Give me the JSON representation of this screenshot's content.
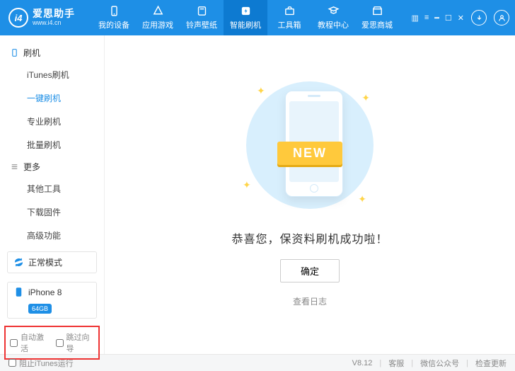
{
  "app": {
    "brand": "爱思助手",
    "site_url": "www.i4.cn",
    "version": "V8.12"
  },
  "nav": {
    "devices": "我的设备",
    "games": "应用游戏",
    "wallpapers": "铃声壁纸",
    "flash": "智能刷机",
    "toolbox": "工具箱",
    "tutorial": "教程中心",
    "shop": "爱思商城"
  },
  "sidebar": {
    "group_flash": "刷机",
    "items_flash": {
      "itunes": "iTunes刷机",
      "oneclick": "一键刷机",
      "pro": "专业刷机",
      "batch": "批量刷机"
    },
    "group_more": "更多",
    "items_more": {
      "other": "其他工具",
      "download": "下载固件",
      "advanced": "高级功能"
    },
    "mode_label": "正常模式",
    "device_name": "iPhone 8",
    "device_capacity": "64GB",
    "auto_activate": "自动激活",
    "skip_wizard": "跳过向导"
  },
  "main": {
    "ribbon": "NEW",
    "success_msg": "恭喜您，保资料刷机成功啦！",
    "ok_btn": "确定",
    "view_log": "查看日志"
  },
  "footer": {
    "block_itunes": "阻止iTunes运行",
    "support": "客服",
    "wechat": "微信公众号",
    "update": "检查更新"
  }
}
